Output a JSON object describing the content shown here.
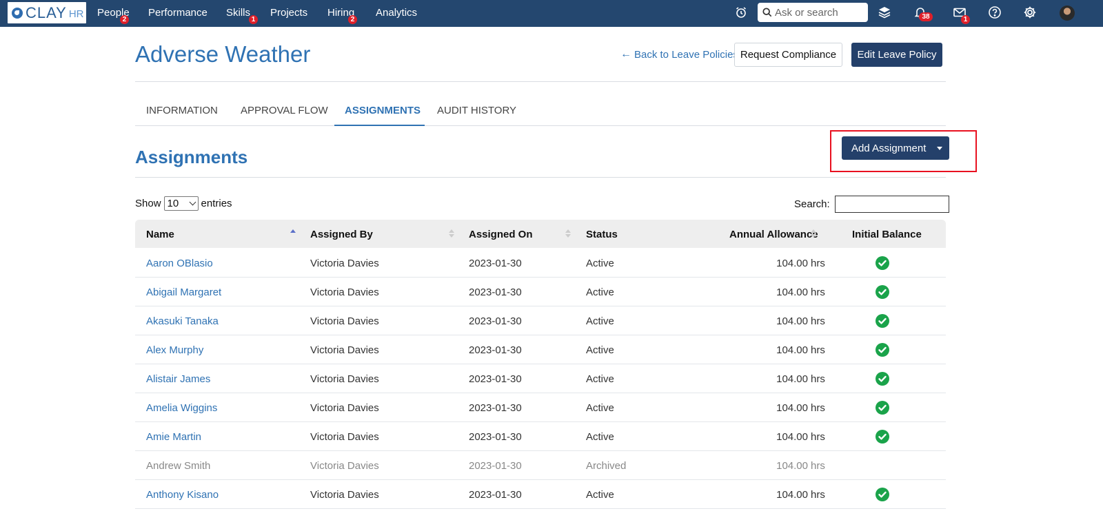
{
  "nav": {
    "logo_text": "CLAY",
    "logo_sub": "HR",
    "items": [
      {
        "label": "People",
        "badge": "2"
      },
      {
        "label": "Performance",
        "badge": ""
      },
      {
        "label": "Skills",
        "badge": "1"
      },
      {
        "label": "Projects",
        "badge": ""
      },
      {
        "label": "Hiring",
        "badge": "2"
      },
      {
        "label": "Analytics",
        "badge": ""
      }
    ],
    "search_placeholder": "Ask or search",
    "notifications_badge": "38",
    "messages_badge": "1",
    "icons": [
      "alarm-clock-icon",
      "layers-icon",
      "bell-icon",
      "mail-icon",
      "help-icon",
      "gear-icon"
    ]
  },
  "header": {
    "title": "Adverse Weather",
    "back_link": "Back to Leave Policies",
    "request_compliance": "Request Compliance",
    "edit_policy": "Edit Leave Policy"
  },
  "tabs": [
    "INFORMATION",
    "APPROVAL FLOW",
    "ASSIGNMENTS",
    "AUDIT HISTORY"
  ],
  "active_tab": "ASSIGNMENTS",
  "section": {
    "title": "Assignments",
    "add_button": "Add Assignment"
  },
  "table_controls": {
    "show_label": "Show",
    "entries_value": "10",
    "entries_label": "entries",
    "search_label": "Search:",
    "search_value": ""
  },
  "table": {
    "columns": [
      "Name",
      "Assigned By",
      "Assigned On",
      "Status",
      "Annual Allowance",
      "Initial Balance"
    ],
    "rows": [
      {
        "name": "Aaron OBlasio",
        "assigned_by": "Victoria Davies",
        "assigned_on": "2023-01-30",
        "status": "Active",
        "allowance": "104.00",
        "unit": "hrs",
        "initial_balance": true
      },
      {
        "name": "Abigail Margaret",
        "assigned_by": "Victoria Davies",
        "assigned_on": "2023-01-30",
        "status": "Active",
        "allowance": "104.00",
        "unit": "hrs",
        "initial_balance": true
      },
      {
        "name": "Akasuki Tanaka",
        "assigned_by": "Victoria Davies",
        "assigned_on": "2023-01-30",
        "status": "Active",
        "allowance": "104.00",
        "unit": "hrs",
        "initial_balance": true
      },
      {
        "name": "Alex Murphy",
        "assigned_by": "Victoria Davies",
        "assigned_on": "2023-01-30",
        "status": "Active",
        "allowance": "104.00",
        "unit": "hrs",
        "initial_balance": true
      },
      {
        "name": "Alistair James",
        "assigned_by": "Victoria Davies",
        "assigned_on": "2023-01-30",
        "status": "Active",
        "allowance": "104.00",
        "unit": "hrs",
        "initial_balance": true
      },
      {
        "name": "Amelia Wiggins",
        "assigned_by": "Victoria Davies",
        "assigned_on": "2023-01-30",
        "status": "Active",
        "allowance": "104.00",
        "unit": "hrs",
        "initial_balance": true
      },
      {
        "name": "Amie Martin",
        "assigned_by": "Victoria Davies",
        "assigned_on": "2023-01-30",
        "status": "Active",
        "allowance": "104.00",
        "unit": "hrs",
        "initial_balance": true
      },
      {
        "name": "Andrew Smith",
        "assigned_by": "Victoria Davies",
        "assigned_on": "2023-01-30",
        "status": "Archived",
        "allowance": "104.00",
        "unit": "hrs",
        "initial_balance": false
      },
      {
        "name": "Anthony Kisano",
        "assigned_by": "Victoria Davies",
        "assigned_on": "2023-01-30",
        "status": "Active",
        "allowance": "104.00",
        "unit": "hrs",
        "initial_balance": true
      }
    ]
  },
  "colors": {
    "nav_bg": "#24476f",
    "accent": "#2f72b3",
    "dark_button": "#24406a",
    "check_green": "#1aa34a",
    "badge_red": "#e0202a",
    "highlight_box": "#e8101f"
  }
}
